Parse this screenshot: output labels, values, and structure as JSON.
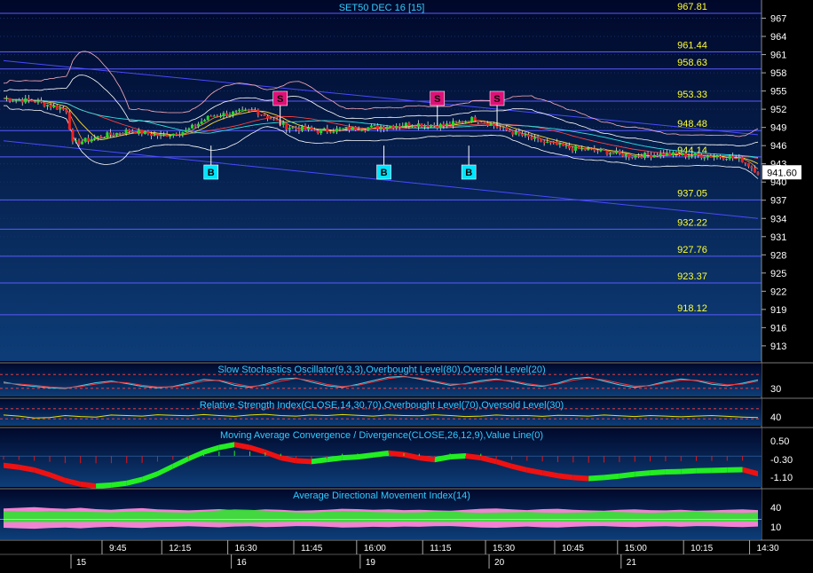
{
  "chart_data": [
    {
      "type": "candlestick",
      "title": "SET50 DEC 16   [15]",
      "y_ticks": [
        967,
        964,
        961,
        958,
        955,
        952,
        949,
        946,
        943,
        940,
        937,
        934,
        931,
        928,
        925,
        922,
        919,
        916,
        913
      ],
      "ylim": [
        910.5,
        970
      ],
      "last_price": "941.60",
      "levels": [
        {
          "value": 967.81,
          "label": "967.81"
        },
        {
          "value": 961.44,
          "label": "961.44"
        },
        {
          "value": 958.63,
          "label": "958.63"
        },
        {
          "value": 953.33,
          "label": "953.33"
        },
        {
          "value": 948.48,
          "label": "948.48"
        },
        {
          "value": 944.14,
          "label": "944.14"
        },
        {
          "value": 937.05,
          "label": "937.05"
        },
        {
          "value": 932.22,
          "label": "932.22"
        },
        {
          "value": 927.76,
          "label": "927.76"
        },
        {
          "value": 923.37,
          "label": "923.37"
        },
        {
          "value": 918.12,
          "label": "918.12"
        }
      ],
      "trend_lines": [
        {
          "from": {
            "bar": 0,
            "price": 960
          },
          "to": {
            "bar": 240,
            "price": 947.8
          }
        },
        {
          "from": {
            "bar": 0,
            "price": 946.8
          },
          "to": {
            "bar": 240,
            "price": 934
          }
        }
      ],
      "signals": [
        {
          "type": "S",
          "bar": 88,
          "price": 951
        },
        {
          "type": "S",
          "bar": 138,
          "price": 951
        },
        {
          "type": "S",
          "bar": 157,
          "price": 951
        },
        {
          "type": "B",
          "bar": 66,
          "price": 946
        },
        {
          "type": "B",
          "bar": 121,
          "price": 946
        },
        {
          "type": "B",
          "bar": 148,
          "price": 946
        }
      ],
      "close_path": [
        [
          0,
          953.8
        ],
        [
          10,
          953.3
        ],
        [
          20,
          951.8
        ],
        [
          22,
          946.3
        ],
        [
          30,
          947.4
        ],
        [
          40,
          948.5
        ],
        [
          50,
          947.6
        ],
        [
          58,
          948.4
        ],
        [
          66,
          950.9
        ],
        [
          80,
          951.8
        ],
        [
          90,
          949.1
        ],
        [
          100,
          948.4
        ],
        [
          110,
          948.8
        ],
        [
          120,
          949.1
        ],
        [
          130,
          949.6
        ],
        [
          140,
          949.3
        ],
        [
          150,
          950.5
        ],
        [
          160,
          948.5
        ],
        [
          170,
          946.8
        ],
        [
          180,
          945.6
        ],
        [
          190,
          945.1
        ],
        [
          200,
          944.3
        ],
        [
          210,
          944.6
        ],
        [
          220,
          944.4
        ],
        [
          230,
          944.2
        ],
        [
          235,
          943.6
        ],
        [
          240,
          941.6
        ]
      ]
    },
    {
      "type": "line",
      "title": "Slow Stochastics Oscillator(9,3,3),Overbought Level(80),Oversold Level(20)",
      "y_ticks": [
        "30"
      ],
      "ylim": [
        0,
        100
      ],
      "series": [
        {
          "color": "#4fd0e8",
          "values": [
            55,
            42,
            35,
            28,
            25,
            38,
            52,
            60,
            48,
            35,
            28,
            34,
            50,
            68,
            62,
            40,
            30,
            45,
            70,
            74,
            55,
            38,
            30,
            45,
            62,
            78,
            82,
            70,
            55,
            40,
            48,
            62,
            70,
            58,
            42,
            35,
            50,
            72,
            78,
            60,
            42,
            30,
            40,
            58,
            70,
            62,
            45,
            38,
            50,
            66
          ]
        },
        {
          "color": "#ff3030",
          "values": [
            50,
            46,
            40,
            32,
            28,
            34,
            46,
            56,
            52,
            40,
            32,
            32,
            44,
            60,
            64,
            48,
            34,
            40,
            60,
            72,
            62,
            44,
            34,
            40,
            56,
            72,
            80,
            74,
            60,
            46,
            46,
            56,
            66,
            62,
            48,
            38,
            46,
            64,
            74,
            66,
            50,
            36,
            38,
            52,
            64,
            64,
            52,
            42,
            46,
            60
          ]
        }
      ]
    },
    {
      "type": "line",
      "title": "Relative Strength Index(CLOSE,14,30,70),Overbought Level(70),Oversold Level(30)",
      "y_ticks": [
        "40"
      ],
      "ylim": [
        20,
        80
      ],
      "series": [
        {
          "color": "#e8e000",
          "values": [
            52,
            48,
            40,
            42,
            50,
            46,
            44,
            52,
            50,
            48,
            53,
            51,
            49,
            54,
            50,
            47,
            52,
            55,
            50,
            48,
            52,
            50,
            54,
            51,
            48,
            52,
            50,
            49,
            53,
            50,
            46,
            48,
            52,
            49,
            50,
            47,
            51,
            50,
            48,
            52,
            49,
            46,
            50,
            48,
            45,
            48,
            50,
            47,
            44,
            42
          ]
        }
      ]
    },
    {
      "type": "bar",
      "title": "Moving Average Convergence / Divergence(CLOSE,26,12,9),Value Line(0)",
      "y_ticks": [
        "0.50",
        "-0.30",
        "-1.10"
      ],
      "ylim": [
        -1.5,
        1.0
      ],
      "values": [
        -0.35,
        -0.45,
        -0.6,
        -0.85,
        -1.15,
        -1.35,
        -1.45,
        -1.4,
        -1.3,
        -1.1,
        -0.8,
        -0.4,
        0.0,
        0.35,
        0.6,
        0.75,
        0.6,
        0.35,
        0.05,
        -0.1,
        -0.15,
        -0.05,
        0.05,
        0.1,
        0.2,
        0.3,
        0.22,
        0.05,
        -0.05,
        0.1,
        0.15,
        0.05,
        -0.15,
        -0.4,
        -0.6,
        -0.75,
        -0.9,
        -1.0,
        -1.05,
        -1.0,
        -0.92,
        -0.82,
        -0.75,
        -0.7,
        -0.68,
        -0.64,
        -0.62,
        -0.6,
        -0.58,
        -0.8
      ]
    },
    {
      "type": "area",
      "title": "Average Directional Movement Index(14)",
      "y_ticks": [
        "40",
        "10"
      ],
      "ylim": [
        0,
        50
      ],
      "series": [
        {
          "color": "#ff88d8",
          "values": [
            34,
            36,
            38,
            35,
            33,
            36,
            32,
            30,
            33,
            35,
            31,
            30,
            28,
            30,
            32,
            29,
            28,
            31,
            30,
            27,
            28,
            30,
            33,
            32,
            30,
            31,
            29,
            30,
            28,
            27,
            30,
            33,
            34,
            31,
            29,
            32,
            33,
            30,
            28,
            27,
            30,
            31,
            29,
            28,
            30,
            27,
            28,
            30,
            31,
            29
          ]
        },
        {
          "color": "#30e030",
          "values": [
            26,
            25,
            24,
            26,
            25,
            24,
            23,
            22,
            24,
            25,
            23,
            22,
            21,
            24,
            28,
            31,
            30,
            27,
            24,
            22,
            21,
            24,
            26,
            25,
            23,
            22,
            21,
            22,
            24,
            25,
            22,
            20,
            21,
            22,
            23,
            21,
            20,
            21,
            22,
            24,
            23,
            21,
            20,
            22,
            23,
            24,
            22,
            21,
            20,
            22
          ]
        }
      ]
    }
  ],
  "time_axis": {
    "ticks": [
      {
        "bar": 11,
        "label": "9:45"
      },
      {
        "bar": 30,
        "label": "12:15"
      },
      {
        "bar": 51,
        "label": "16:30"
      },
      {
        "bar": 72,
        "label": "11:45"
      },
      {
        "bar": 92,
        "label": "16:00"
      },
      {
        "bar": 113,
        "label": "11:15"
      },
      {
        "bar": 133,
        "label": "15:30"
      },
      {
        "bar": 155,
        "label": "10:45"
      },
      {
        "bar": 175,
        "label": "15:00"
      },
      {
        "bar": 196,
        "label": "10:15"
      },
      {
        "bar": 217,
        "label": "14:30"
      }
    ],
    "days": [
      {
        "bar": 0,
        "label": "15"
      },
      {
        "bar": 51,
        "label": "16"
      },
      {
        "bar": 92,
        "label": "19"
      },
      {
        "bar": 133,
        "label": "20"
      },
      {
        "bar": 175,
        "label": "21"
      }
    ]
  },
  "colors": {
    "background_top": "#00082a",
    "background_bottom": "#0d3d78",
    "level_line": "#5a5aff",
    "level_label": "#ffff33",
    "title": "#33ccff",
    "axis_text": "#ffffff",
    "up_candle": "#22dd22",
    "down_candle": "#ee2222",
    "sell_marker": "#dd1177",
    "buy_marker": "#00e5ff",
    "last_price_box": "#ffffff"
  }
}
